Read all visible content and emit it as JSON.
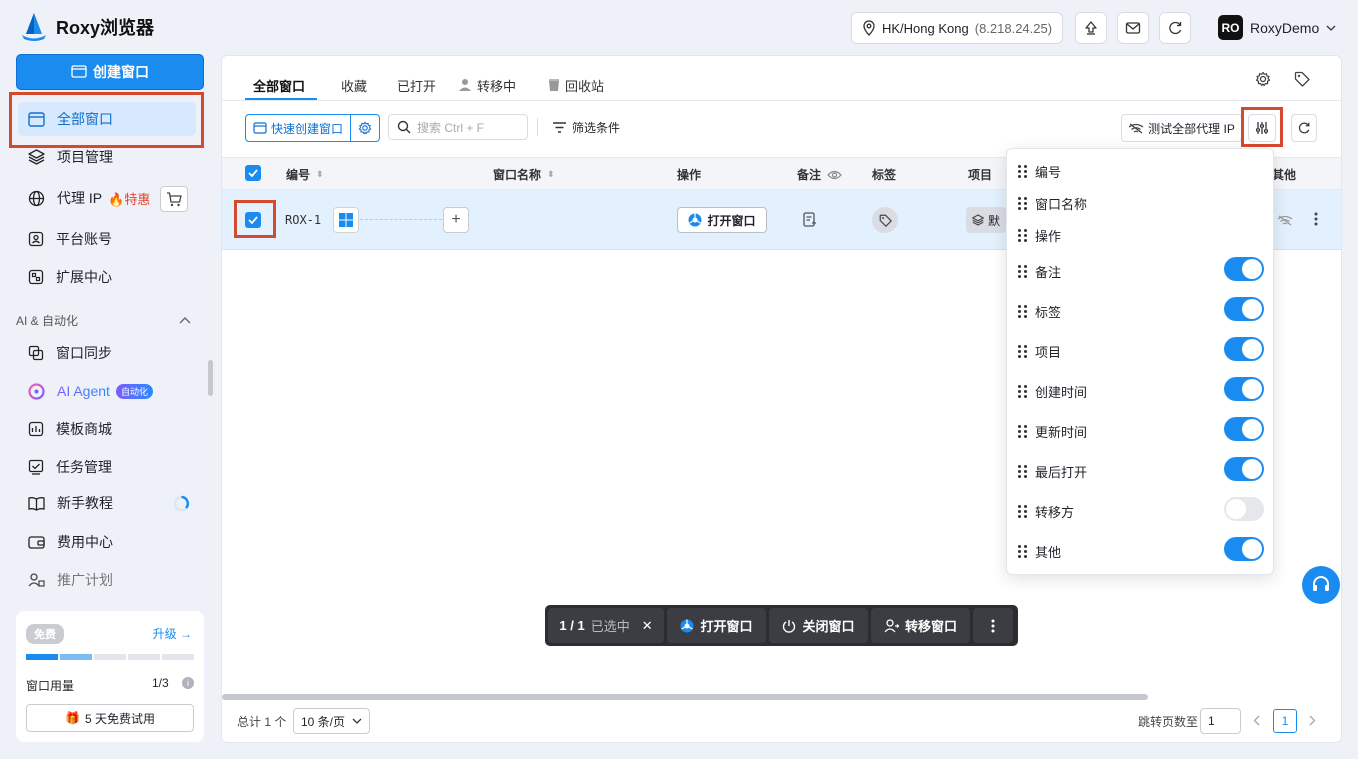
{
  "app": {
    "name": "Roxy浏览器"
  },
  "header": {
    "location": "HK/Hong Kong",
    "ip": "(8.218.24.25)",
    "user_initials": "RO",
    "user_name": "RoxyDemo"
  },
  "sidebar": {
    "create_label": "创建窗口",
    "items": [
      {
        "label": "全部窗口",
        "icon": "window-icon"
      },
      {
        "label": "项目管理",
        "icon": "layers-icon"
      },
      {
        "label": "代理 IP",
        "icon": "globe-icon",
        "hot_label": "特惠"
      },
      {
        "label": "平台账号",
        "icon": "account-icon"
      },
      {
        "label": "扩展中心",
        "icon": "extension-icon"
      }
    ],
    "section_label": "AI & 自动化",
    "ai_items": [
      {
        "label": "窗口同步",
        "icon": "sync-icon"
      },
      {
        "label": "AI Agent",
        "icon": "ai-icon",
        "badge": "自动化"
      },
      {
        "label": "模板商城",
        "icon": "store-icon"
      },
      {
        "label": "任务管理",
        "icon": "task-icon"
      },
      {
        "label": "新手教程",
        "icon": "book-icon"
      },
      {
        "label": "费用中心",
        "icon": "wallet-icon"
      },
      {
        "label": "推广计划",
        "icon": "promo-icon"
      }
    ],
    "plan": {
      "tier": "免费",
      "upgrade": "升级 →",
      "usage_label": "窗口用量",
      "usage_value": "1/3",
      "usage_fraction": 0.333,
      "trial": "5 天免费试用"
    }
  },
  "tabs": [
    "全部窗口",
    "收藏",
    "已打开",
    "转移中",
    "回收站"
  ],
  "toolbar": {
    "quick_create": "快速创建窗口",
    "search_placeholder": "搜索 Ctrl + F",
    "filter": "筛选条件",
    "test_proxy": "测试全部代理 IP"
  },
  "table": {
    "headers": {
      "id": "编号",
      "name": "窗口名称",
      "action": "操作",
      "note": "备注",
      "tag": "标签",
      "project": "项目",
      "other": "其他"
    },
    "rows": [
      {
        "id": "ROX-1",
        "os": "windows",
        "action": "打开窗口",
        "project": "默"
      }
    ]
  },
  "column_settings": [
    {
      "label": "编号",
      "toggle": null
    },
    {
      "label": "窗口名称",
      "toggle": null
    },
    {
      "label": "操作",
      "toggle": null
    },
    {
      "label": "备注",
      "toggle": true
    },
    {
      "label": "标签",
      "toggle": true
    },
    {
      "label": "项目",
      "toggle": true
    },
    {
      "label": "创建时间",
      "toggle": true
    },
    {
      "label": "更新时间",
      "toggle": true
    },
    {
      "label": "最后打开",
      "toggle": true
    },
    {
      "label": "转移方",
      "toggle": false
    },
    {
      "label": "其他",
      "toggle": true
    }
  ],
  "action_bar": {
    "selected": "1 / 1",
    "selected_suffix": "已选中",
    "open": "打开窗口",
    "close": "关闭窗口",
    "transfer": "转移窗口"
  },
  "footer": {
    "total": "总计 1 个",
    "page_size": "10 条/页",
    "jump_label": "跳转页数至",
    "jump_value": "1",
    "current_page": "1"
  },
  "colors": {
    "accent": "#1a8cf0",
    "highlight_box": "#d44a30"
  }
}
